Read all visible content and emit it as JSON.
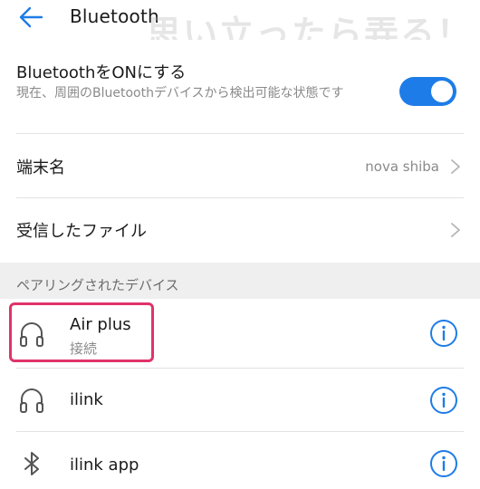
{
  "header": {
    "title": "Bluetooth",
    "watermark": "思い立ったら弄る！"
  },
  "bluetooth_toggle": {
    "title": "BluetoothをONにする",
    "description": "現在、周囲のBluetoothデバイスから検出可能な状態です",
    "enabled": true,
    "accent_color": "#1e7ce8"
  },
  "device_name": {
    "label": "端末名",
    "value": "nova shiba"
  },
  "received_files": {
    "label": "受信したファイル"
  },
  "paired_section": {
    "label": "ペアリングされたデバイス",
    "devices": [
      {
        "name": "Air plus",
        "status": "接続",
        "icon": "headphones-icon"
      },
      {
        "name": "ilink",
        "status": "",
        "icon": "headphones-icon"
      },
      {
        "name": "ilink app",
        "status": "",
        "icon": "bluetooth-icon"
      }
    ]
  },
  "highlight_color": "#e0336a"
}
